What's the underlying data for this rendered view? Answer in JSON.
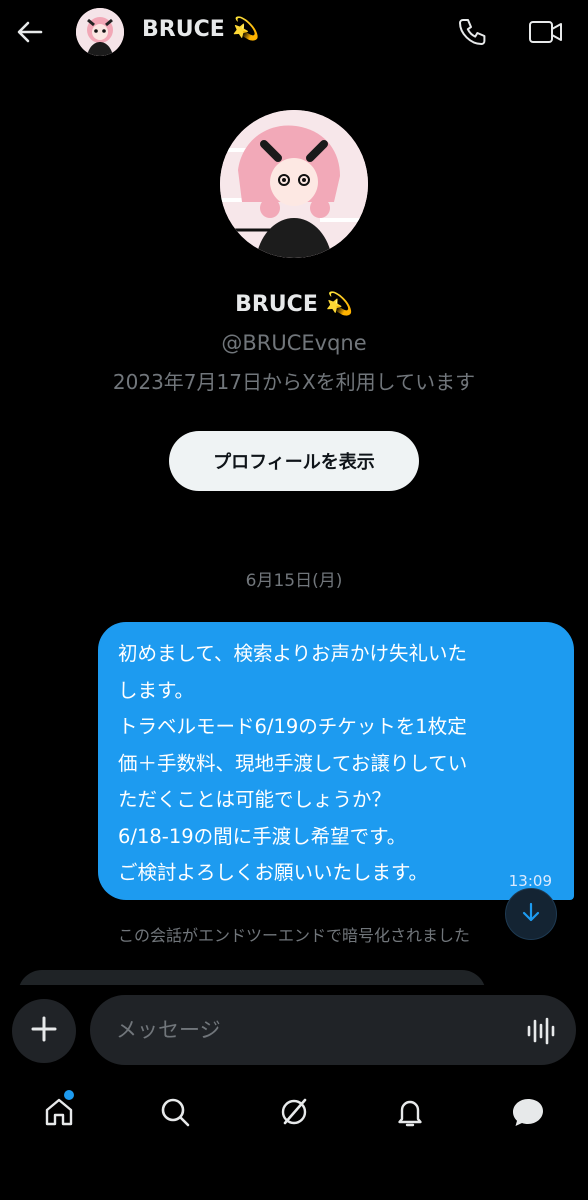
{
  "header": {
    "name": "BRUCE 💫"
  },
  "profile": {
    "name": "BRUCE 💫",
    "handle": "@BRUCEvqne",
    "joined": "2023年7月17日からXを利用しています",
    "button_label": "プロフィールを表示"
  },
  "conversation": {
    "date_separator": "6月15日(月)",
    "messages": [
      {
        "sender": "me",
        "lines": [
          "初めまして、検索よりお声かけ失礼いた",
          "します。",
          "トラベルモード6/19のチケットを1枚定",
          "価＋手数料、現地手渡してお譲りしてい",
          "ただくことは可能でしょうか？",
          "6/18-19の間に手渡し希望です。",
          "ご検討よろしくお願いいたします。"
        ],
        "time": "13:09"
      }
    ],
    "encryption_note": "この会話がエンドツーエンドで暗号化されました"
  },
  "composer": {
    "placeholder": "メッセージ"
  },
  "icons": {
    "back": "arrow-left-icon",
    "call": "phone-icon",
    "video": "video-camera-icon",
    "add": "plus-icon",
    "voice": "voice-waveform-icon",
    "scroll": "arrow-down-icon",
    "nav": [
      "home-icon",
      "search-icon",
      "grok-icon",
      "bell-icon",
      "messages-icon"
    ]
  },
  "colors": {
    "background": "#000000",
    "accent": "#1d9bf0",
    "muted_text": "#71767b",
    "input_bg": "#202327",
    "button_bg": "#eff3f4"
  },
  "nav": {
    "home_has_notification": true
  }
}
